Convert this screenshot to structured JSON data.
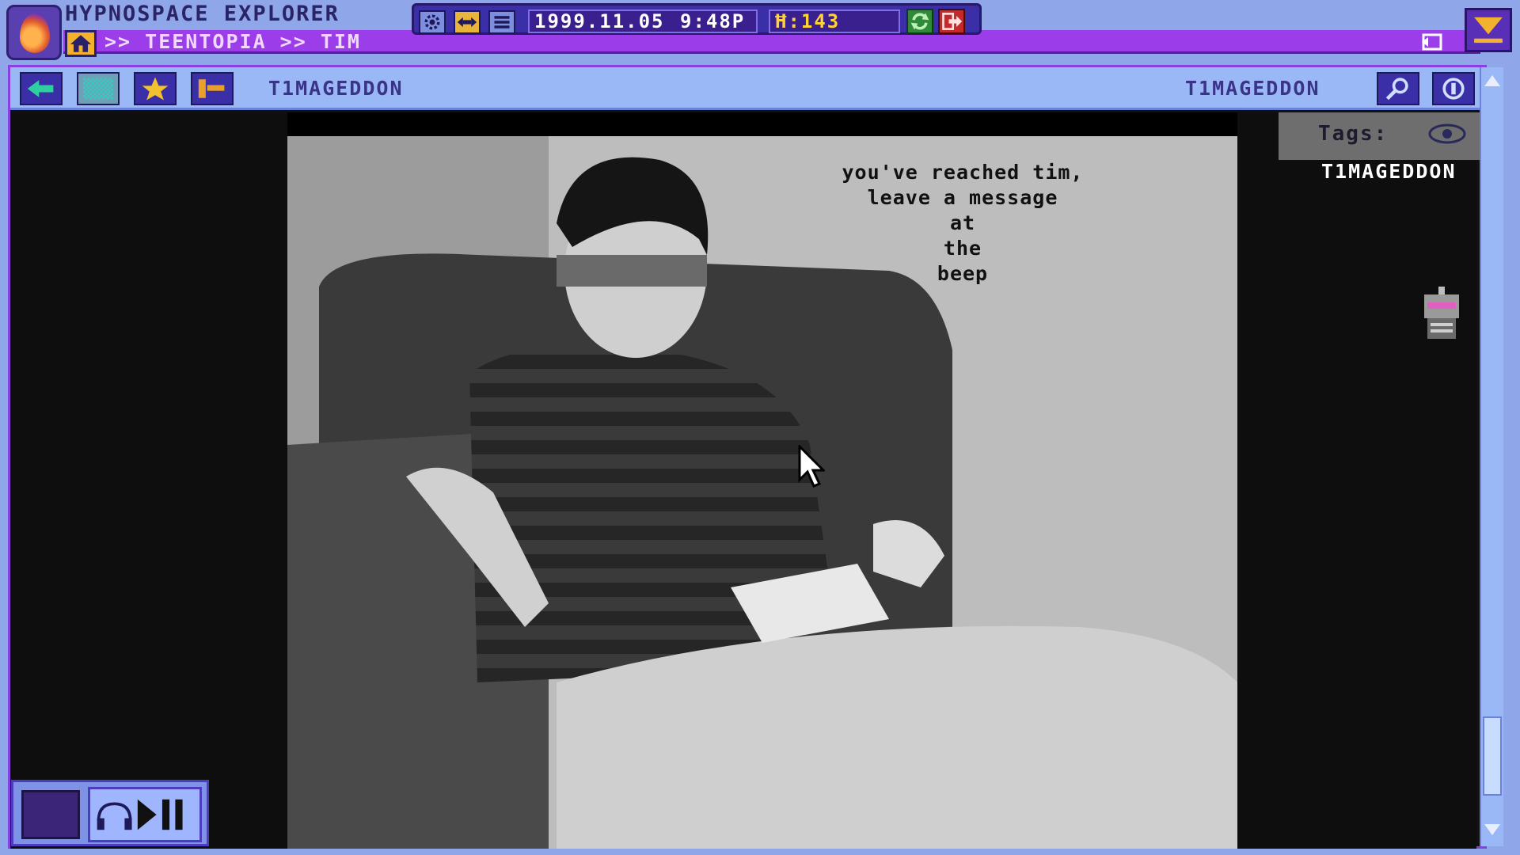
{
  "app": {
    "title": "HYPNOSPACE EXPLORER",
    "breadcrumb": ">> TEENTOPIA >> TIM"
  },
  "status": {
    "date": "1999.11.05",
    "time": "9:48P",
    "coins": "Ħ:143"
  },
  "toolbar": {
    "page_name_left": "T1MAGEDDON",
    "page_name_right": "T1MAGEDDON"
  },
  "page": {
    "caption": "you've reached tim,\nleave a message\nat\nthe\nbeep"
  },
  "tags": {
    "label": "Tags:",
    "items": [
      "T1MAGEDDON"
    ]
  },
  "icons": {
    "logo": "hypnospace-logo-icon",
    "home": "home-icon",
    "settings": "gear-icon",
    "resize": "resize-arrows-icon",
    "menu": "list-icon",
    "refresh": "refresh-icon",
    "exit": "exit-icon",
    "minimize": "minimize-icon",
    "undo": "return-icon",
    "back": "back-arrow-icon",
    "wallpaper": "wallpaper-icon",
    "favorite": "star-icon",
    "bookmark": "bookmark-icon",
    "search": "search-icon",
    "coin": "coin-icon",
    "eye": "eye-icon",
    "bot": "robot-icon",
    "headphones": "headphones-icon",
    "play_pause": "play-pause-icon"
  },
  "colors": {
    "chrome": "#8fa6e8",
    "accent_purple": "#9b3de8",
    "panel_navy": "#3b2fa8",
    "coin_yellow": "#ffd23a"
  }
}
